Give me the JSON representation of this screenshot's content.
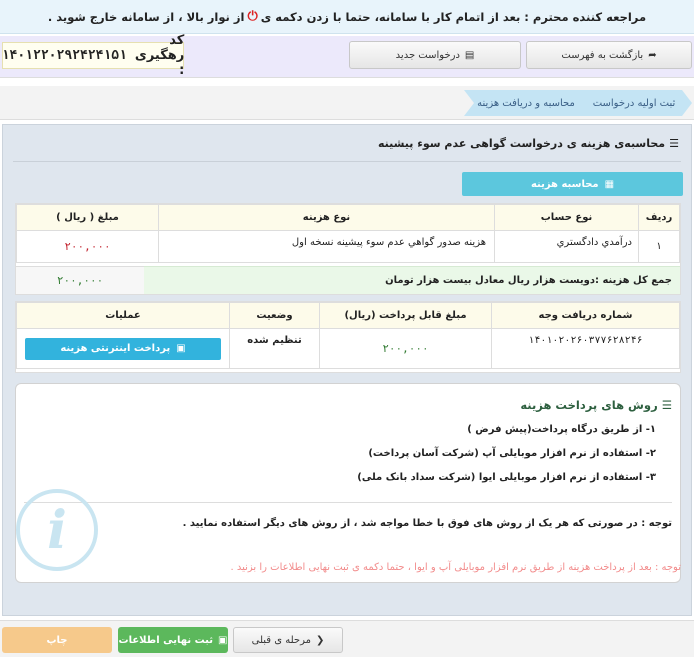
{
  "notice": {
    "text_before": "مراجعه کننده محترم : بعد از اتمام کار با سامانه، حتما با زدن دکمه ی",
    "text_after": "از نوار بالا ، از سامانه خارج شوید ."
  },
  "topbar": {
    "back_label": "بازگشت به فهرست",
    "new_request_label": "درخواست جدید",
    "tracking_label": "کد رهگیری :",
    "tracking_code": "۱۴۰۱۲۲۰۲۹۲۴۲۴۱۵۱"
  },
  "breadcrumb": {
    "items": [
      "ثبت اولیه درخواست",
      "محاسبه و دریافت هزینه"
    ]
  },
  "section": {
    "title": "محاسبه‌ی هزینه ی درخواست گواهی عدم سوء پیشینه",
    "calc_button": "محاسبه هزینه"
  },
  "cost_table": {
    "headers": [
      "ردیف",
      "نوع حساب",
      "نوع هزینه",
      "مبلغ ( ریال )"
    ],
    "rows": [
      {
        "index": "۱",
        "account": "درآمدي دادگستري",
        "cost_type": "هزینه صدور گواهي عدم سوء پيشينه نسخه اول",
        "amount": "۲۰۰,۰۰۰"
      }
    ],
    "total_label": "جمع کل هزینه :دویست هزار ریال معادل بیست هزار تومان",
    "total_amount": "۲۰۰,۰۰۰"
  },
  "payment_table": {
    "headers": [
      "شماره دریافت وجه",
      "مبلغ قابل پرداخت (ریال)",
      "وضعیت",
      "عملیات"
    ],
    "row": {
      "receipt_no": "۱۴۰۱۰۲۰۲۶۰۳۷۷۶۲۸۲۴۶",
      "amount": "۲۰۰,۰۰۰",
      "status": "تنظیم شده",
      "pay_button": "پرداخت اینترنتی هزینه"
    }
  },
  "methods": {
    "title": "روش های پرداخت هزینه",
    "items": [
      "۱- از طریق درگاه پرداخت(پیش فرض )",
      "۲- استفاده از نرم افزار موبایلی آپ (شرکت آسان پرداخت)",
      "۳- استفاده از نرم افزار موبایلی ایوا (شرکت سداد بانک ملی)"
    ],
    "note": "توجه : در صورتی که هر یک از روش های فوق با خطا مواجه شد ، از روش های دیگر استفاده نمایید ."
  },
  "warning": "توجه : بعد از پرداخت هزینه از طریق نرم افزار موبایلی آپ و ایوا ، حتما دکمه ی ثبت نهایی اطلاعات را بزنید .",
  "bottom": {
    "prev_label": "مرحله ی قبلی",
    "submit_label": "ثبت نهایی اطلاعات",
    "print_label": "چاپ"
  }
}
